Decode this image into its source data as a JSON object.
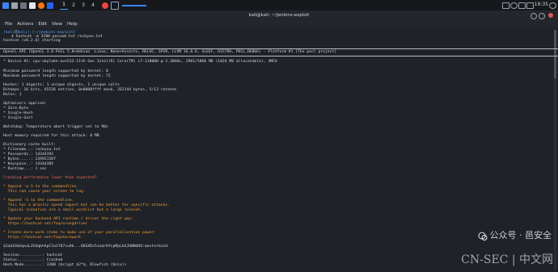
{
  "taskbar": {
    "workspaces": [
      "1",
      "2",
      "3",
      "4"
    ],
    "clock": "19:35"
  },
  "window": {
    "title": "kali@kali: ~/jenkins-exploit"
  },
  "menu": [
    "File",
    "Actions",
    "Edit",
    "View",
    "Help"
  ],
  "terminal": {
    "prompt_user": "(kali㉿kali)-[~/jenkins-exploit]",
    "command": "$ hashcat -m 3200 passwd.txt rockyou.txt",
    "lines": [
      "hashcat (v6.2.6) starting",
      "OpenCL API (OpenCL 3.0 PoCL 5.0+debian  Linux, None+Asserts, RELOC, SPIR, LLVM 16.0.6, SLEEF, DISTRO, POCL_DEBUG) - Platform #1 [The pocl project]",
      "* Device #1: cpu-skylake-avx512-11th Gen Intel(R) Core(TM) i7-11800H @ 2.30GHz, 2901/5866 MB (1024 MB allocatable), 4MCU",
      "Minimum password length supported by kernel: 0",
      "Maximum password length supported by kernel: 72",
      "Hashes: 1 digests; 1 unique digests, 1 unique salts",
      "Bitmaps: 16 bits, 65536 entries, 0x0000ffff mask, 262144 bytes, 5/13 rotates",
      "Rules: 1",
      "Optimizers applied:",
      "* Zero-Byte",
      "* Single-Hash",
      "* Single-Salt",
      "Watchdog: Temperature abort trigger set to 90c",
      "Host memory required for this attack: 0 MB",
      "Dictionary cache built:",
      "* Filename..: rockyou.txt",
      "* Passwords.: 14344392",
      "* Bytes.....: 139921507",
      "* Keyspace..: 14344385",
      "* Runtime...: 1 sec"
    ],
    "warning_lines": [
      "Cracking performance lower than expected?",
      "* Append -w 3 to the commandline.",
      "  This can cause your screen to lag.",
      "* Append -S to the commandline.",
      "  This has a drastic speed impact but can be better for specific attacks.",
      "  Typical scenarios are a small wordlist but a large ruleset.",
      "* Update your backend API runtime / driver the right way:",
      "  https://hashcat.net/faq/wrongdriver",
      "* Create more work items to make use of your parallelization power:",
      "  https://hashcat.net/faq/morework"
    ],
    "cracked": "$2a$10$GqnuLZhOqbhApC3aJf07cuAk...Q6GXDv5zad/HfcpMpLbGJUNNdDO:mastermind",
    "status_lines": [
      "Session..........: hashcat",
      "Status...........: Cracked",
      "Hash.Mode........: 3200 (bcrypt $2*$, Blowfish (Unix))"
    ]
  },
  "watermark": {
    "line1": "公众号 · 邑安全",
    "line2": "CN-SEC | 中文网"
  }
}
